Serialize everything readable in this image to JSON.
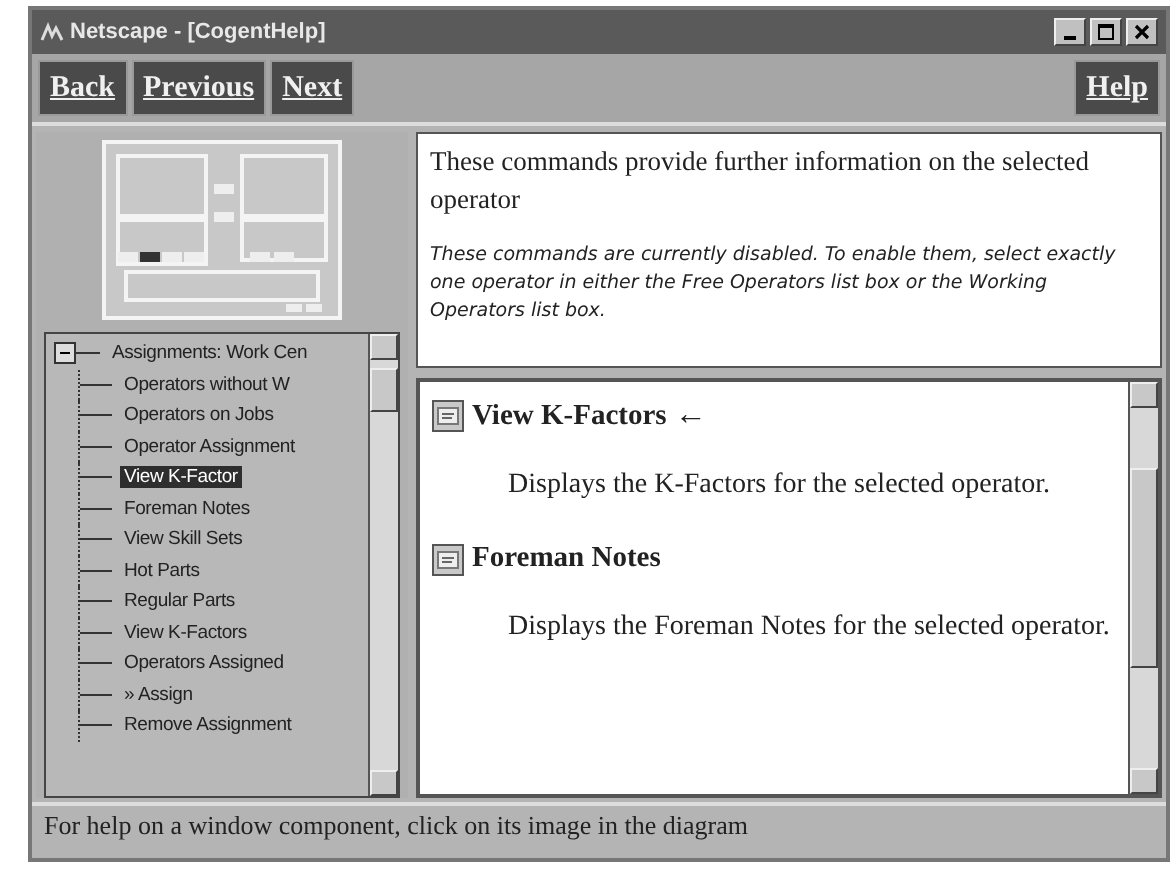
{
  "window": {
    "title": "Netscape - [CogentHelp]"
  },
  "toolbar": {
    "buttons": [
      "Back",
      "Previous",
      "Next"
    ],
    "help": "Help"
  },
  "tree": {
    "label": "Assignments: Work Cen",
    "expanded": true,
    "children": [
      {
        "label": "Operators without W",
        "selected": false
      },
      {
        "label": "Operators on Jobs",
        "selected": false
      },
      {
        "label": "Operator Assignment",
        "selected": false
      },
      {
        "label": "View K-Factor",
        "selected": true
      },
      {
        "label": "Foreman Notes",
        "selected": false
      },
      {
        "label": "View Skill Sets",
        "selected": false
      },
      {
        "label": "Hot Parts",
        "selected": false
      },
      {
        "label": "Regular Parts",
        "selected": false
      },
      {
        "label": "View K-Factors",
        "selected": false
      },
      {
        "label": "Operators Assigned",
        "selected": false
      },
      {
        "label": "» Assign",
        "selected": false
      },
      {
        "label": "Remove Assignment",
        "selected": false
      }
    ]
  },
  "intro": {
    "text": "These commands provide further information on the selected operator",
    "note": "These commands are currently disabled. To enable them, select exactly one operator in either the Free Operators list box or the Working Operators list box."
  },
  "commands": [
    {
      "title": "View K-Factors",
      "marker": "←",
      "description": "Displays the K-Factors for the selected operator."
    },
    {
      "title": "Foreman Notes",
      "description": "Displays the Foreman Notes for the selected operator."
    }
  ],
  "status_bar": "For help on a window component, click on its image in the diagram"
}
